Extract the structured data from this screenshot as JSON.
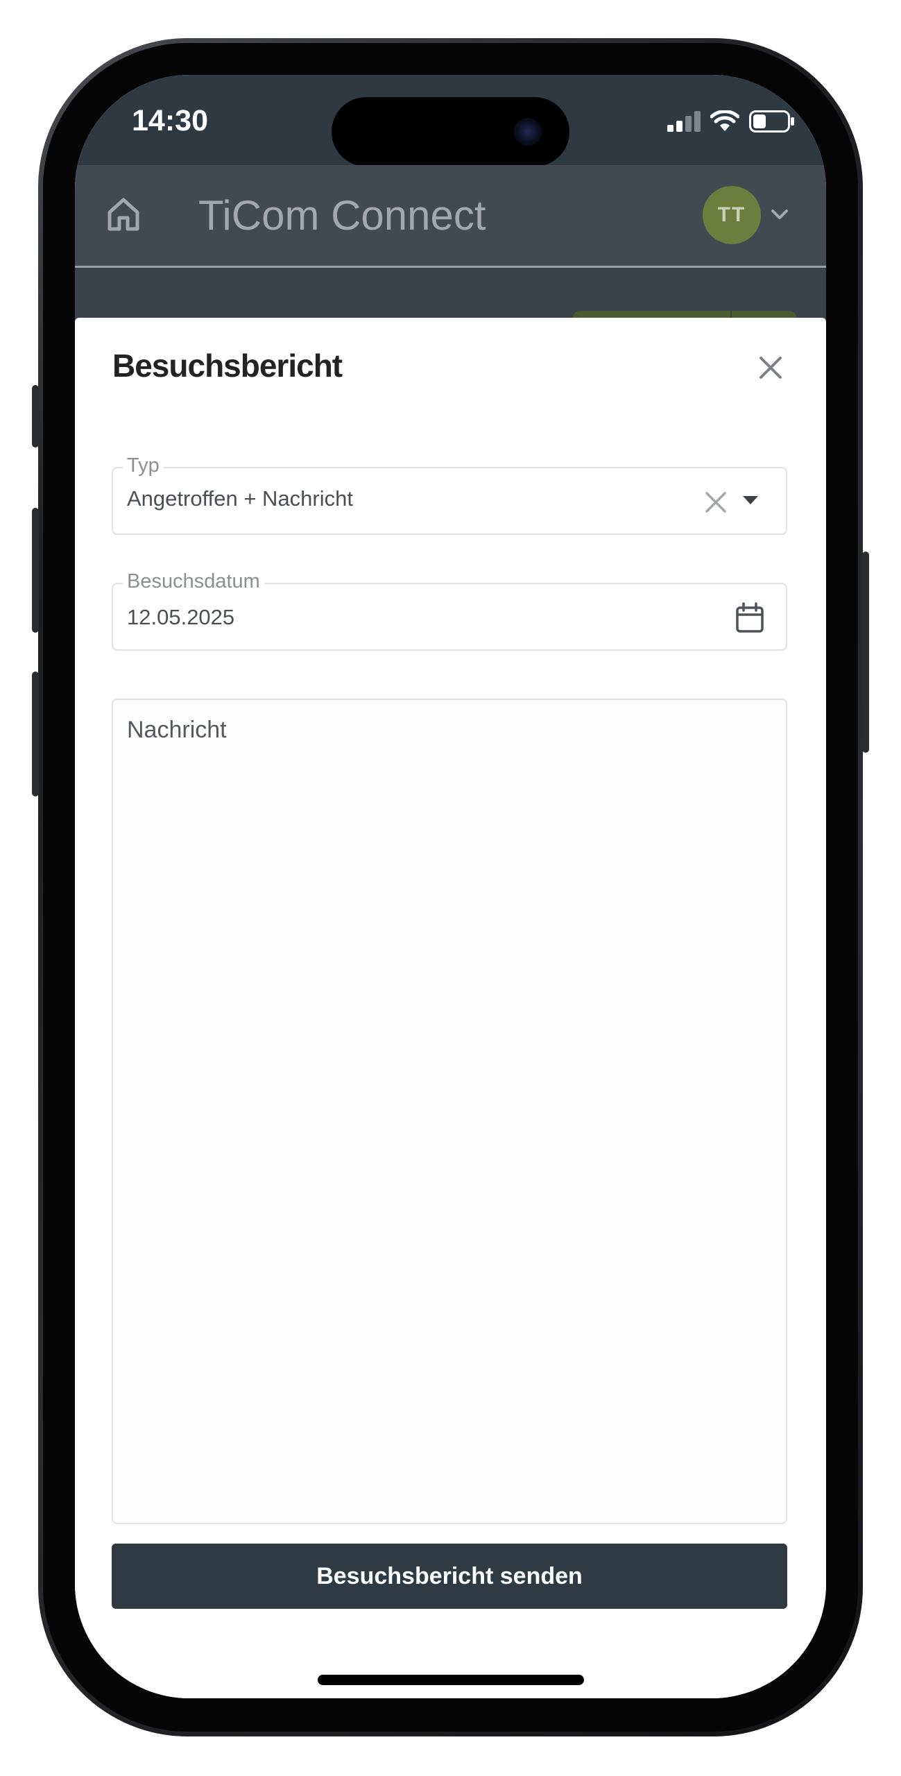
{
  "status_bar": {
    "time": "14:30",
    "icons": [
      "cellular-signal-icon",
      "wifi-icon",
      "battery-icon"
    ]
  },
  "app_header": {
    "title": "TiCom Connect",
    "home_icon": "home-icon",
    "avatar_initials": "TT",
    "avatar_color": "#6d7d3e"
  },
  "modal": {
    "title": "Besuchsbericht",
    "type_field": {
      "label": "Typ",
      "value": "Angetroffen + Nachricht"
    },
    "date_field": {
      "label": "Besuchsdatum",
      "value": "12.05.2025"
    },
    "message_field": {
      "placeholder": "Nachricht"
    },
    "submit_label": "Besuchsbericht senden"
  },
  "colors": {
    "primary_dark": "#2e3a44",
    "header_bg": "#434950",
    "accent_green": "#6d7d3e"
  }
}
